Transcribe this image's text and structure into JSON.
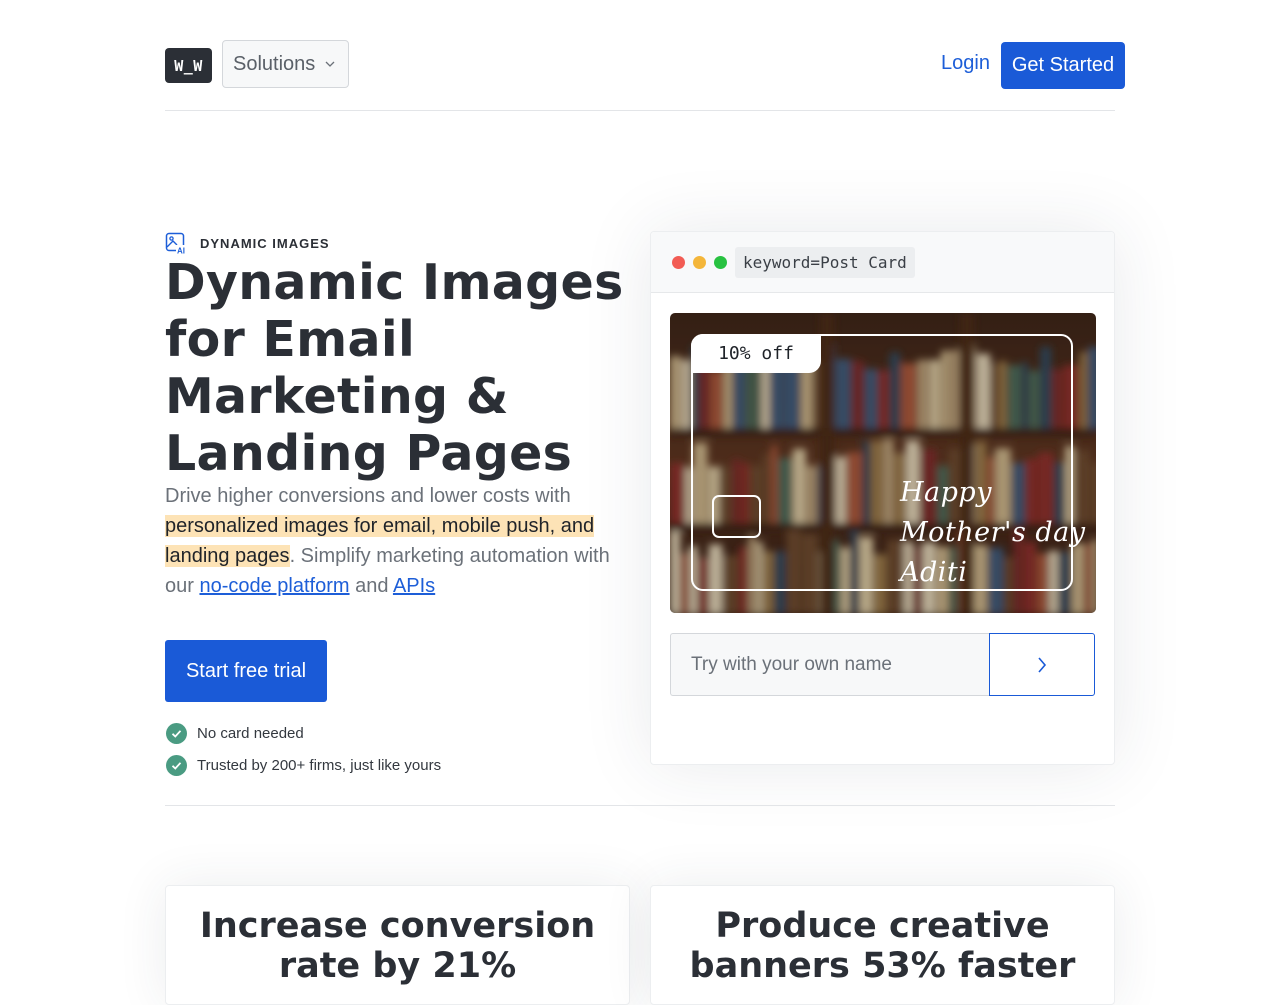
{
  "header": {
    "logo_text": "W_W",
    "solutions_label": "Solutions",
    "login_label": "Login",
    "get_started_label": "Get Started"
  },
  "hero": {
    "eyebrow": "DYNAMIC IMAGES",
    "title": "Dynamic Images for Email Marketing & Landing Pages",
    "desc_before": "Drive higher conversions and lower costs with ",
    "desc_highlight": "personalized images for email, mobile push, and landing pages",
    "desc_middle": ". Simplify marketing automation with our ",
    "desc_link1": "no-code platform",
    "desc_and": " and ",
    "desc_link2": "APIs",
    "cta_label": "Start free trial",
    "checks": [
      "No card needed",
      "Trusted by 200+ firms, just like yours"
    ]
  },
  "demo": {
    "keyword": "keyword=Post Card",
    "dot_colors": [
      "#f25c54",
      "#f4b63a",
      "#28c241"
    ],
    "tag": "10% off",
    "script_lines": [
      "Happy",
      "Mother's day",
      "Aditi"
    ],
    "input_placeholder": "Try with your own name"
  },
  "stats": [
    {
      "text": "Increase conversion rate by 21%"
    },
    {
      "text": "Produce creative banners 53% faster"
    }
  ],
  "colors": {
    "brand_blue": "#1a5ad7",
    "check_green": "#4a9b82",
    "highlight": "#fde3b6"
  }
}
